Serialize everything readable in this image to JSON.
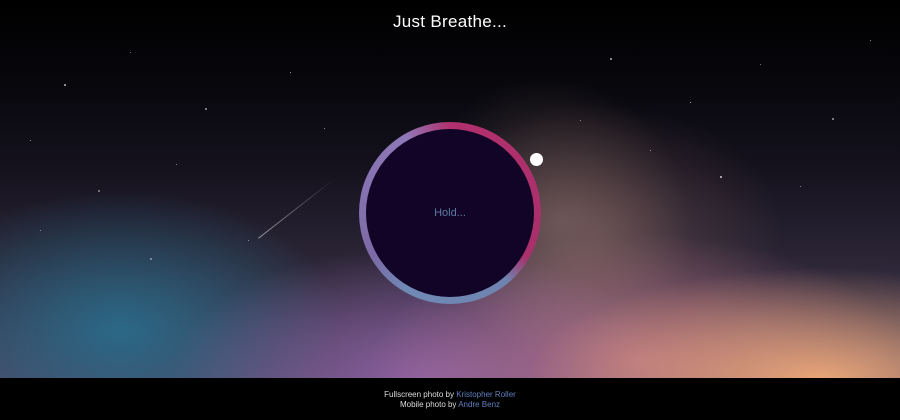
{
  "app": {
    "title": "Just Breathe..."
  },
  "breathe": {
    "instruction": "Hold...",
    "colors": {
      "inner": "#120426",
      "ring_magenta": "#b1306d",
      "ring_blue": "#6f89b5",
      "ring_purple": "#8f79b8",
      "pointer": "#ffffff"
    }
  },
  "footer": {
    "fullscreen_prefix": "Fullscreen photo by",
    "fullscreen_author": "Kristopher Roller",
    "mobile_prefix": "Mobile photo by",
    "mobile_author": "Andre Benz",
    "link_color": "#5f7fc0"
  }
}
